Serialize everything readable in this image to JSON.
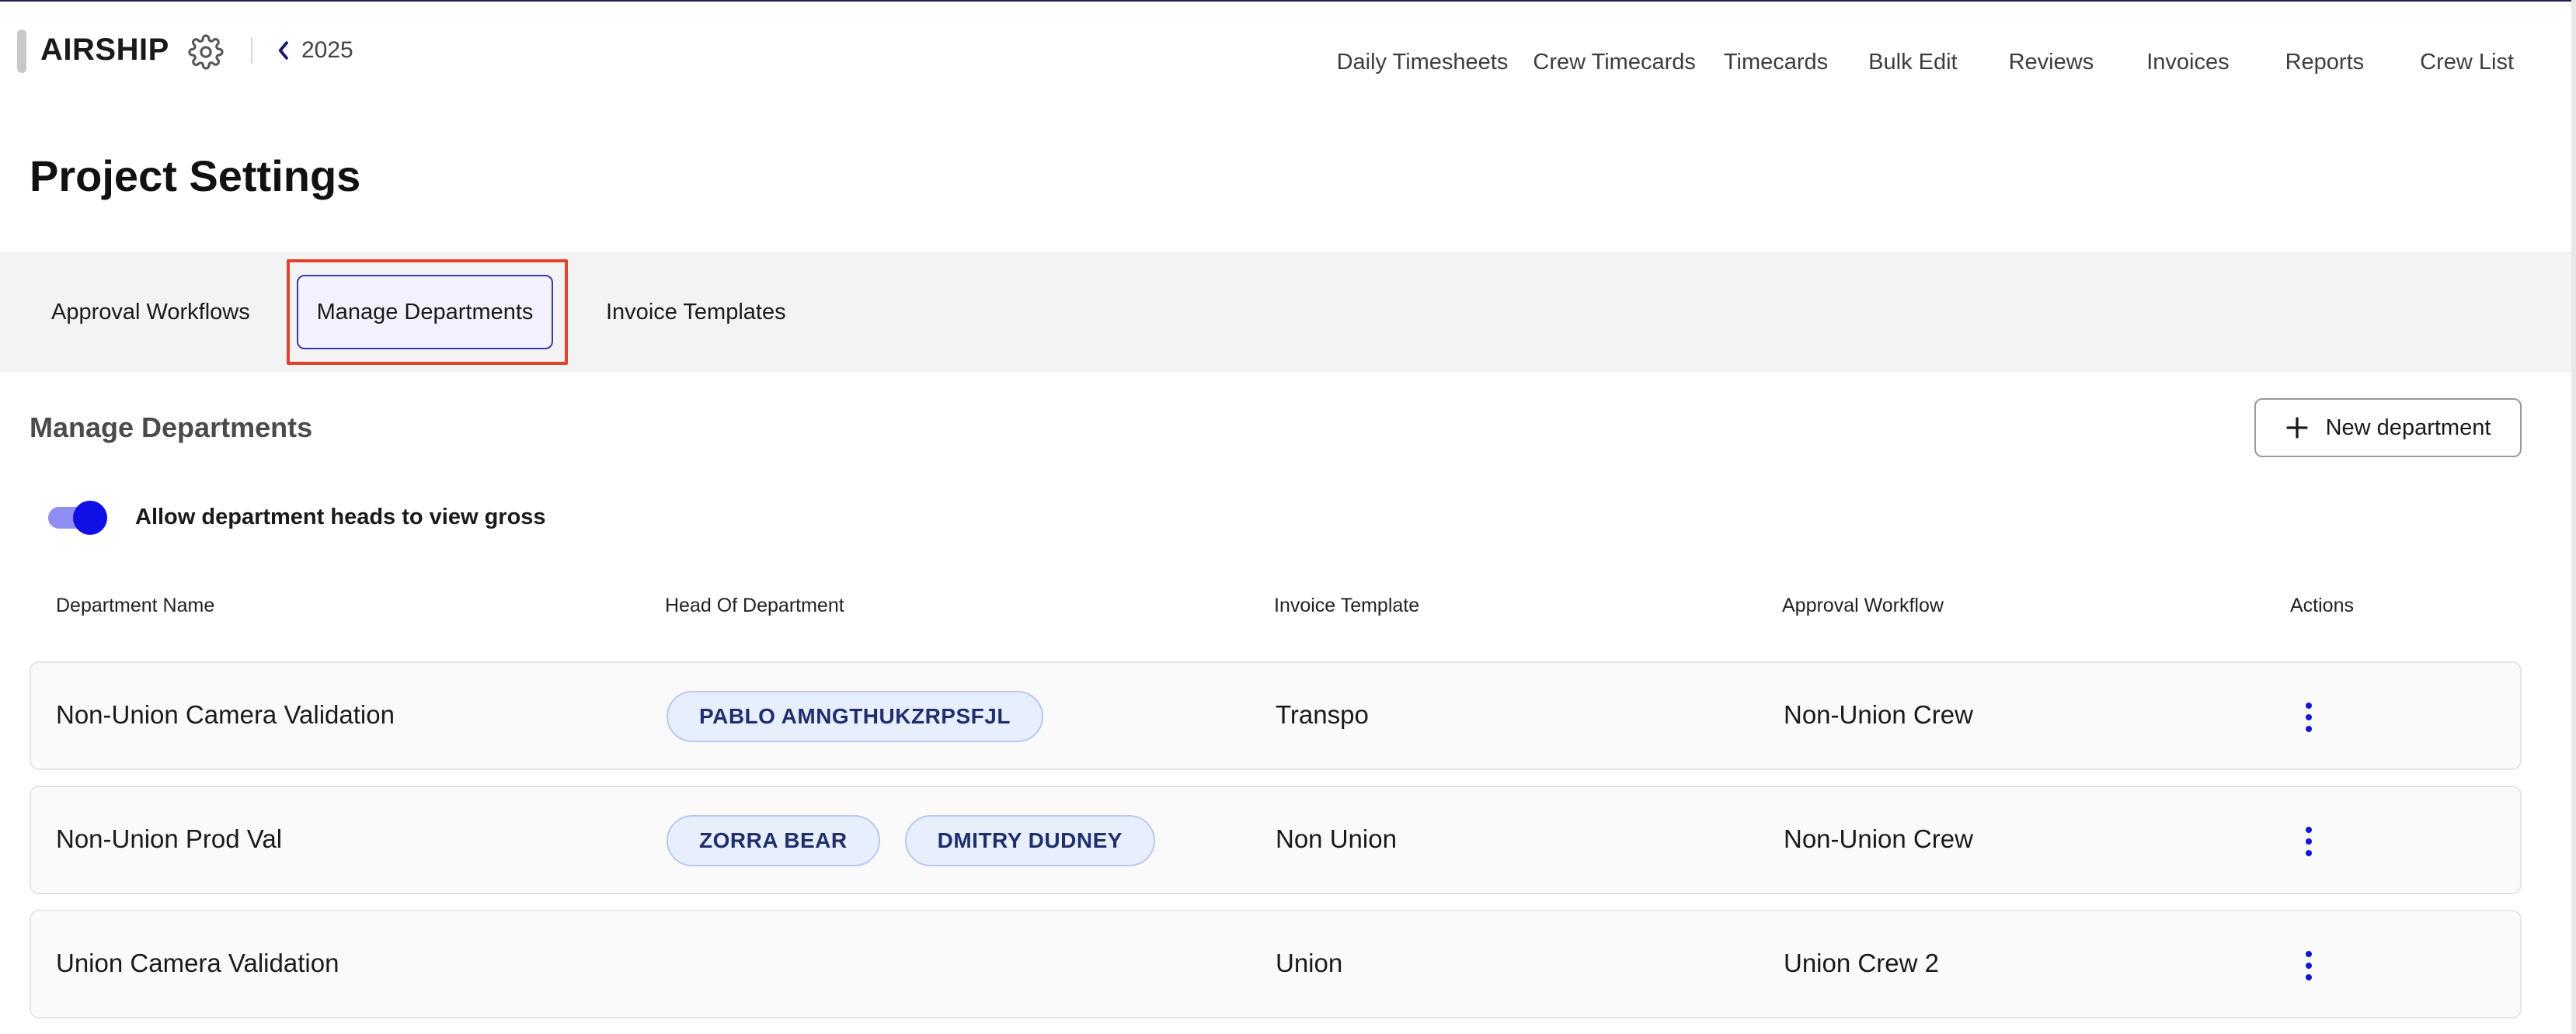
{
  "header": {
    "brand": "AIRSHIP",
    "settings_icon": "gear-icon",
    "back_icon": "chevron-left-icon",
    "year": "2025",
    "nav": [
      {
        "label": "Daily Timesheets"
      },
      {
        "label": "Crew Timecards"
      },
      {
        "label": "Timecards"
      },
      {
        "label": "Bulk Edit"
      },
      {
        "label": "Reviews"
      },
      {
        "label": "Invoices"
      },
      {
        "label": "Reports"
      },
      {
        "label": "Crew List"
      }
    ]
  },
  "page": {
    "title": "Project Settings"
  },
  "tabs": [
    {
      "label": "Approval Workflows",
      "active": false
    },
    {
      "label": "Manage Departments",
      "active": true
    },
    {
      "label": "Invoice Templates",
      "active": false
    }
  ],
  "section": {
    "title": "Manage Departments",
    "new_button_label": "New department",
    "new_button_icon": "plus-icon",
    "toggle": {
      "label": "Allow department heads to view gross",
      "on": true
    }
  },
  "table": {
    "columns": [
      "Department Name",
      "Head Of Department",
      "Invoice Template",
      "Approval Workflow",
      "Actions"
    ],
    "rows": [
      {
        "name": "Non-Union Camera Validation",
        "heads": [
          "PABLO AMNGTHUKZRPSFJL"
        ],
        "invoice_template": "Transpo",
        "approval_workflow": "Non-Union Crew"
      },
      {
        "name": "Non-Union Prod Val",
        "heads": [
          "ZORRA BEAR",
          "DMITRY DUDNEY"
        ],
        "invoice_template": "Non Union",
        "approval_workflow": "Non-Union Crew"
      },
      {
        "name": "Union Camera Validation",
        "heads": [],
        "invoice_template": "Union",
        "approval_workflow": "Union Crew 2"
      }
    ]
  },
  "colors": {
    "accent": "#1010e6",
    "toggle_track": "#8e8ef4",
    "chip_bg": "#e8effc",
    "chip_text": "#1f2f6e",
    "highlight": "#e2412b"
  }
}
